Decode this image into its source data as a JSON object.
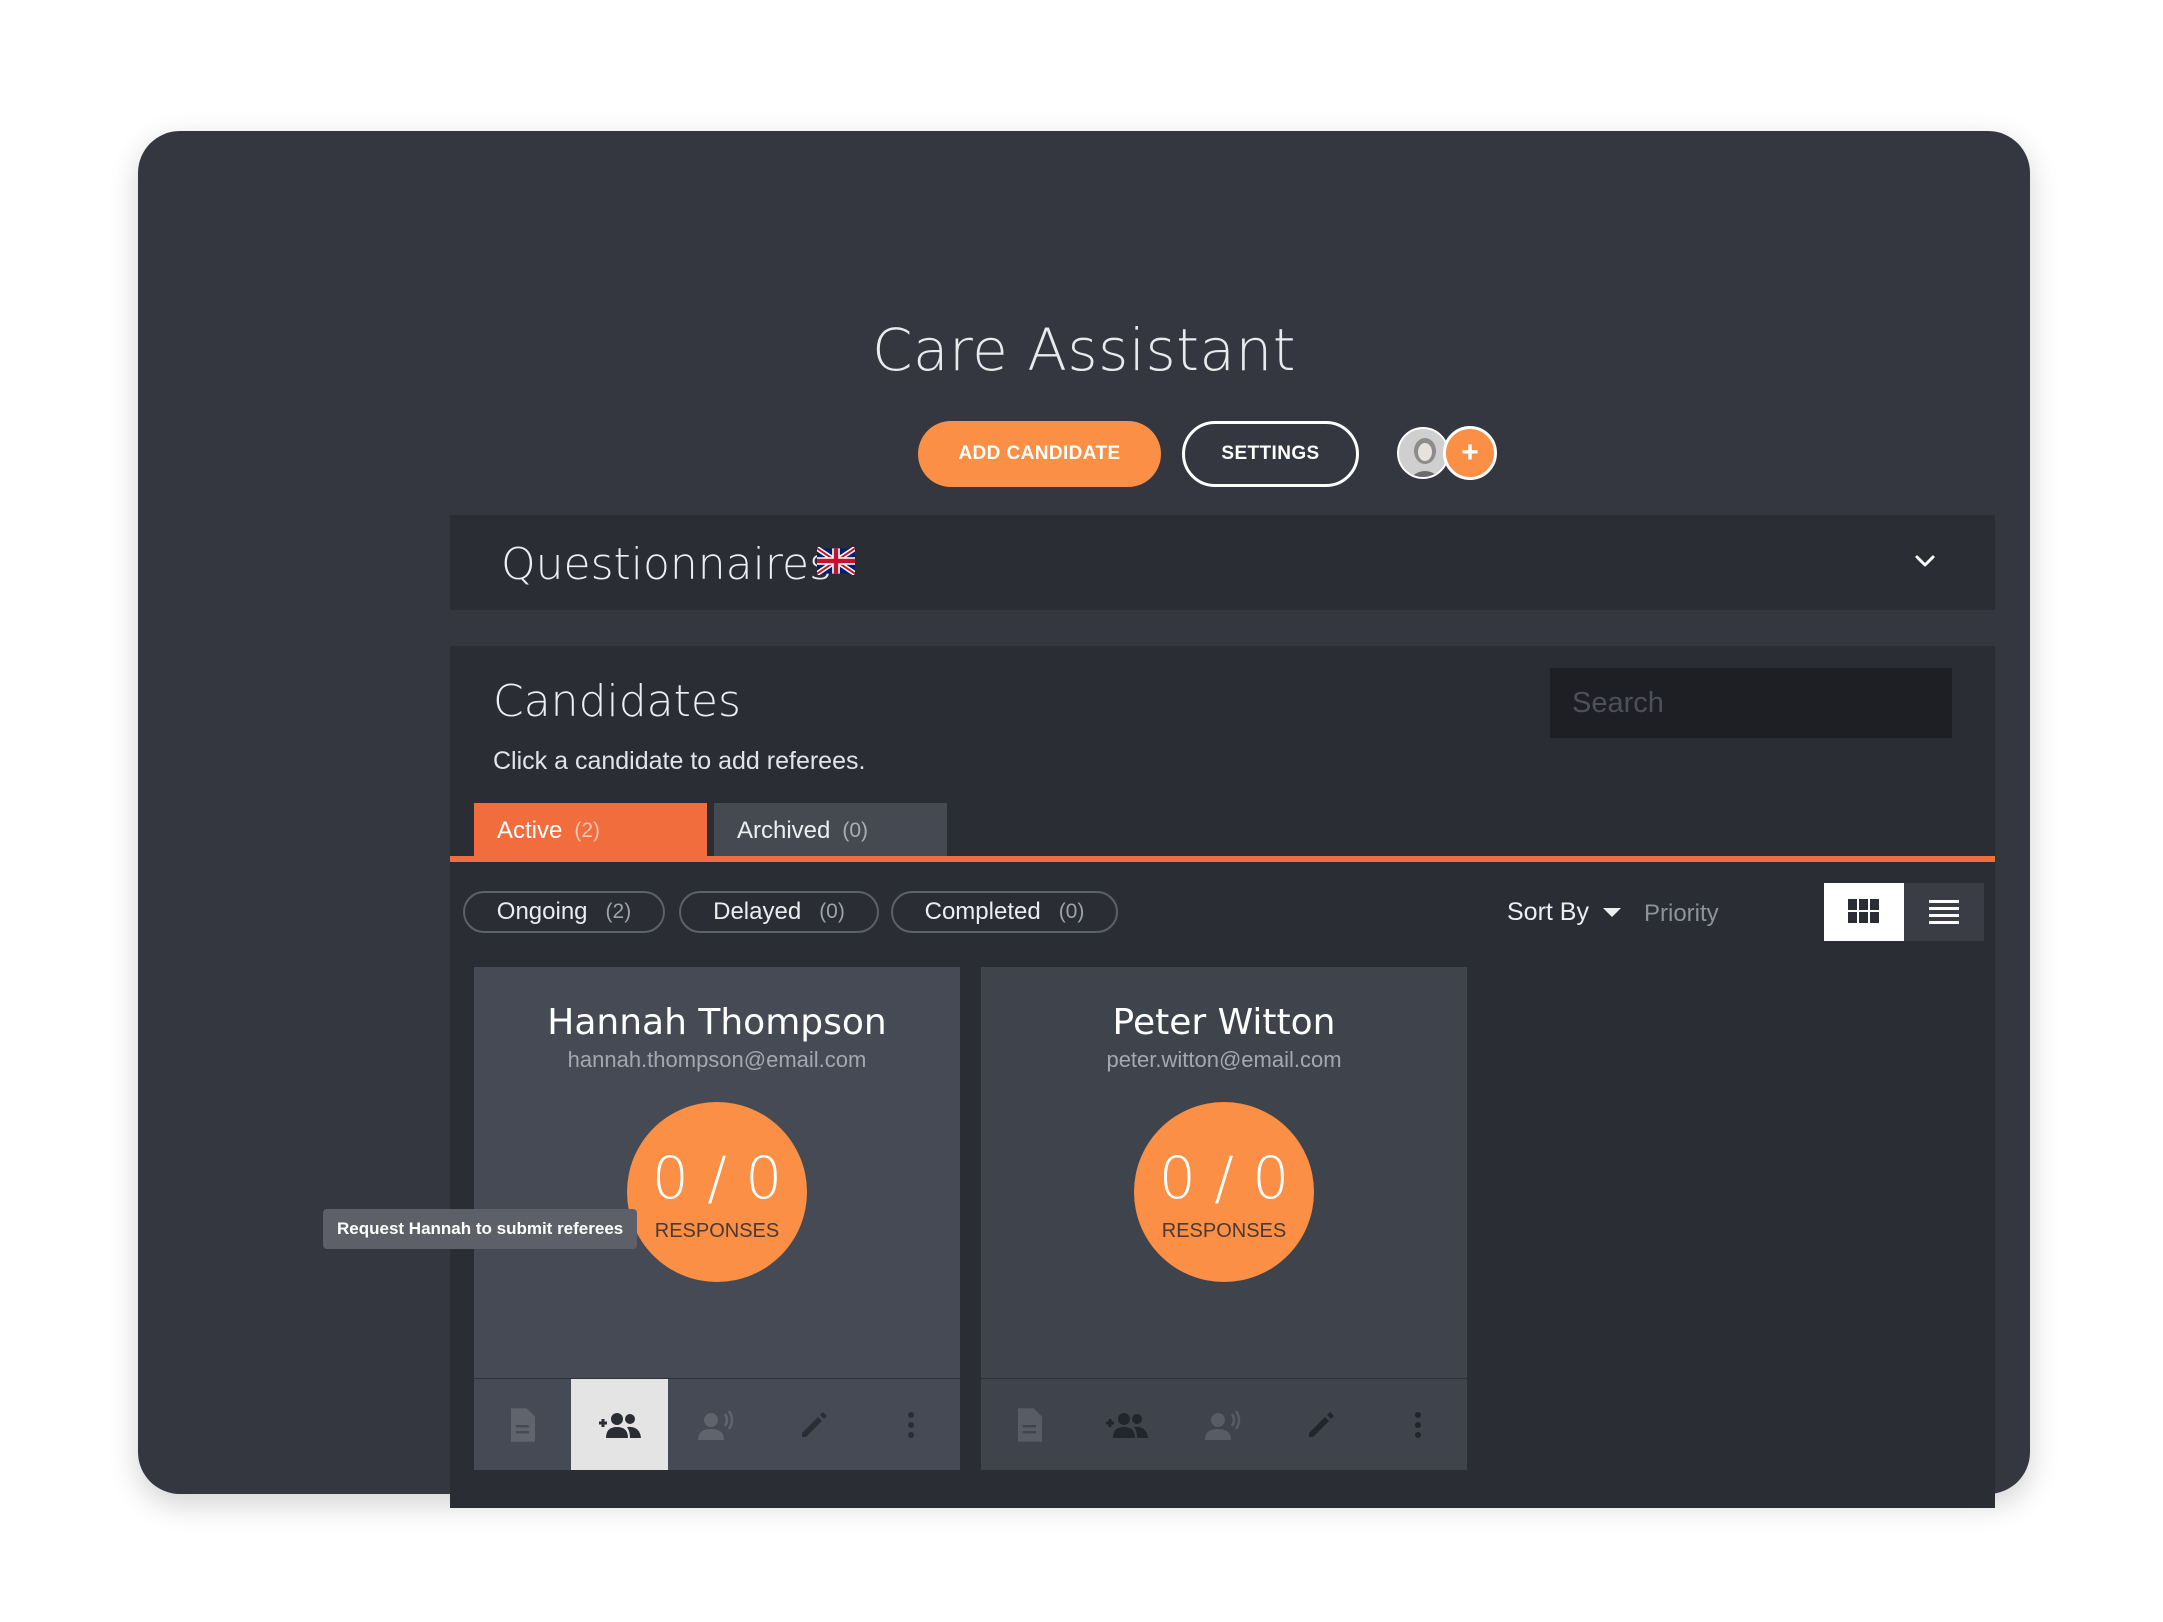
{
  "header": {
    "title": "Care Assistant",
    "add_candidate_label": "ADD CANDIDATE",
    "settings_label": "SETTINGS",
    "add_member_symbol": "+"
  },
  "questionnaires": {
    "title": "Questionnaires",
    "language_icon": "uk-flag-icon",
    "expand_icon": "chevron-down-icon"
  },
  "candidates": {
    "title": "Candidates",
    "subtitle": "Click a candidate to add referees.",
    "search_placeholder": "Search",
    "tabs": [
      {
        "label": "Active",
        "count": "(2)",
        "active": true
      },
      {
        "label": "Archived",
        "count": "(0)",
        "active": false
      }
    ],
    "filters": [
      {
        "label": "Ongoing",
        "count": "(2)"
      },
      {
        "label": "Delayed",
        "count": "(0)"
      },
      {
        "label": "Completed",
        "count": "(0)"
      }
    ],
    "sort_label": "Sort By",
    "sort_value": "Priority",
    "view_mode": "grid",
    "cards": [
      {
        "name": "Hannah Thompson",
        "email": "hannah.thompson@email.com",
        "responses": "0 / 0",
        "responses_label": "RESPONSES"
      },
      {
        "name": "Peter Witton",
        "email": "peter.witton@email.com",
        "responses": "0 / 0",
        "responses_label": "RESPONSES"
      }
    ],
    "tooltip": "Request Hannah to submit referees"
  },
  "colors": {
    "accent": "#fb8f45",
    "tab_active": "#f26d3d",
    "frame_bg": "#343740",
    "panel_bg": "#2b2d35"
  }
}
